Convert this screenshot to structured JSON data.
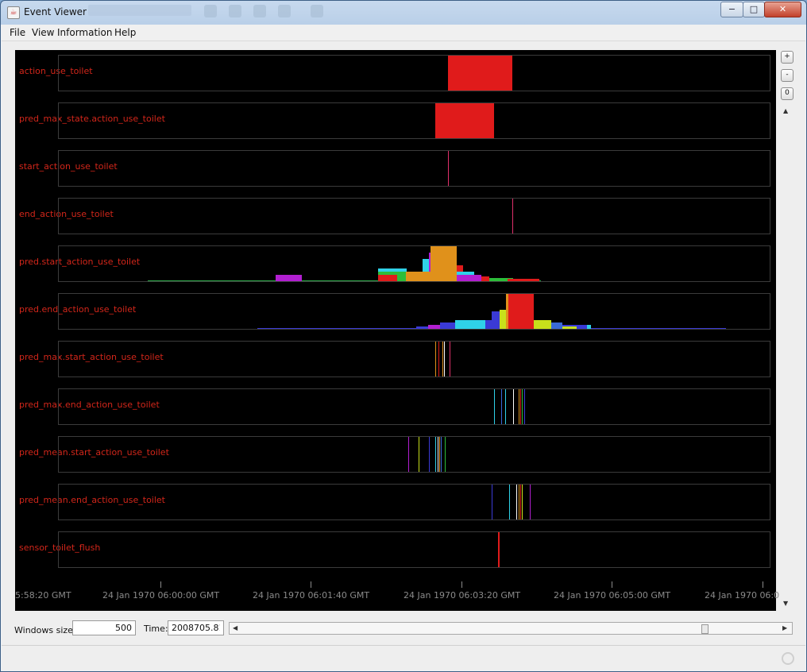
{
  "window": {
    "title": "Event Viewer",
    "controls": {
      "minimize": "−",
      "maximize": "□",
      "close": "✕"
    }
  },
  "menu": {
    "file": "File",
    "view": "View",
    "information": "Information",
    "help": "Help"
  },
  "side_buttons": {
    "zoom_in": "+",
    "zoom_out": "-",
    "reset": "0"
  },
  "colors": {
    "label": "#d2261a",
    "plot_bg": "#000000",
    "axis_text": "#8a8a8a"
  },
  "rows": [
    "action_use_toilet",
    "pred_max_state.action_use_toilet",
    "start_action_use_toilet",
    "end_action_use_toilet",
    "pred.start_action_use_toilet",
    "pred.end_action_use_toilet",
    "pred_max.start_action_use_toilet",
    "pred_max.end_action_use_toilet",
    "pred_mean.start_action_use_toilet",
    "pred_mean.end_action_use_toilet",
    "sensor_toilet_flush"
  ],
  "time_axis": [
    "5:58:20 GMT",
    "24 Jan 1970 06:00:00 GMT",
    "24 Jan 1970 06:01:40 GMT",
    "24 Jan 1970 06:03:20 GMT",
    "24 Jan 1970 06:05:00 GMT",
    "24 Jan 1970 06:0"
  ],
  "controls": {
    "window_size_label": "Windows size:",
    "window_size_value": "500",
    "time_label": "Time:",
    "time_value": "2008705.810"
  },
  "scroll": {
    "horizontal_position": 0.86
  }
}
